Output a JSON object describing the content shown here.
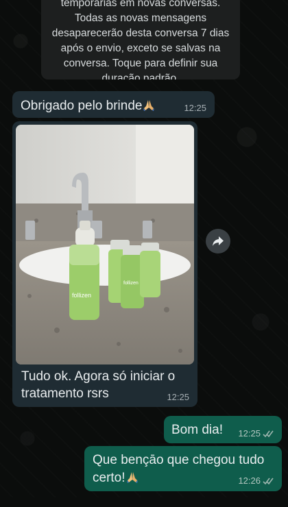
{
  "system_notice": {
    "text": "temporárias em novas conversas. Todas as novas mensagens desaparecerão desta conversa 7 dias após o envio, exceto se salvas na conversa. Toque para definir sua duração padrão."
  },
  "messages": [
    {
      "direction": "incoming",
      "text": "Obrigado pelo brinde",
      "emoji": "folded-hands",
      "time": "12:25"
    },
    {
      "direction": "incoming",
      "type": "photo",
      "photo_label": "follizen",
      "caption": "Tudo ok. Agora só iniciar o tratamento rsrs",
      "time": "12:25"
    },
    {
      "direction": "outgoing",
      "text": "Bom dia!",
      "time": "12:25",
      "status": "read"
    },
    {
      "direction": "outgoing",
      "text": "Que bençāo que chegou tudo certo!",
      "emoji": "folded-hands",
      "time": "12:26",
      "status": "read"
    }
  ],
  "colors": {
    "incoming_bubble": "#1f2c33",
    "outgoing_bubble": "#0f5d4c",
    "background": "#0b0d0c"
  },
  "icons": {
    "forward": "forward-arrow-icon",
    "read_receipt": "double-check-icon",
    "emoji": "folded-hands-emoji"
  }
}
